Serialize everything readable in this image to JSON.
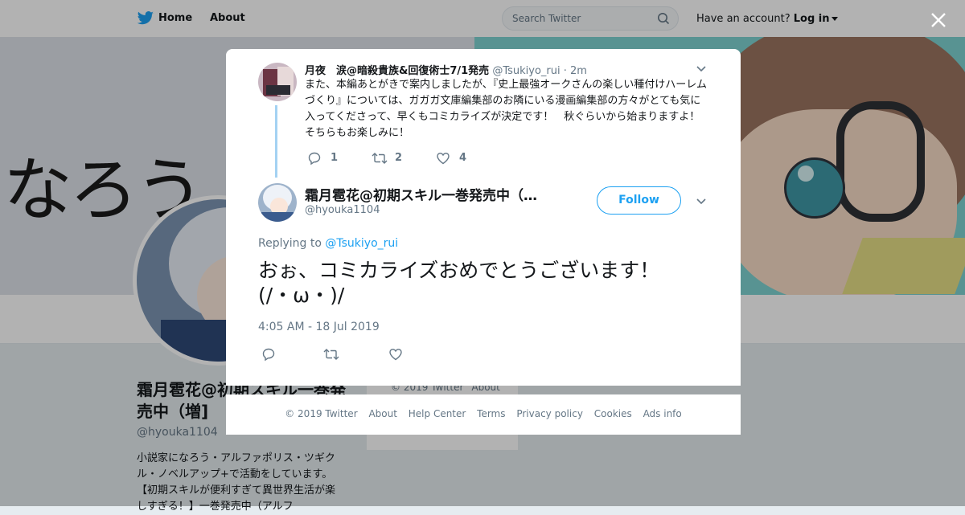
{
  "topbar": {
    "home_label": "Home",
    "about_label": "About",
    "search_placeholder": "Search Twitter",
    "have_account": "Have an account?",
    "login_label": "Log in"
  },
  "banner": {
    "text": "なろう ﾉ"
  },
  "profile": {
    "name": "霜月雹花@初期スキル一巻発売中（増]",
    "handle": "@hyouka1104",
    "bio": "小説家になろう・アルファポリス・ツギクル・ノベルアップ+で活動をしています。【初期スキルが便利すぎて異世界生活が楽しすぎる！】一巻発売中（アルフ"
  },
  "side_footer": {
    "copyright": "© 2019 Twitter",
    "about": "About"
  },
  "parent_tweet": {
    "name": "月夜　涙@暗殺貴族&回復術士7/1発売",
    "handle": "@Tsukiyo_rui",
    "time": "· 2m",
    "text": "また、本編あとがきで案内しましたが、『史上最強オークさんの楽しい種付けハーレムづくり』については、ガガガ文庫編集部のお隣にいる漫画編集部の方々がとても気に入ってくださって、早くもコミカライズが決定です！　秋ぐらいから始まりますよ！　そちらもお楽しみに！",
    "reply_count": "1",
    "retweet_count": "2",
    "like_count": "4"
  },
  "main_tweet": {
    "name": "霜月雹花@初期スキル一巻発売中（…",
    "handle": "@hyouka1104",
    "follow_label": "Follow",
    "replying_prefix": "Replying to",
    "replying_to": "@Tsukiyo_rui",
    "text": "おぉ、コミカライズおめでとうございます！(/・ω・)/",
    "timestamp": "4:05 AM - 18 Jul 2019"
  },
  "footer": {
    "links": [
      "© 2019 Twitter",
      "About",
      "Help Center",
      "Terms",
      "Privacy policy",
      "Cookies",
      "Ads info"
    ]
  },
  "colors": {
    "accent": "#1da1f2",
    "thread_line": "#a3d2f2",
    "muted": "#657786"
  }
}
